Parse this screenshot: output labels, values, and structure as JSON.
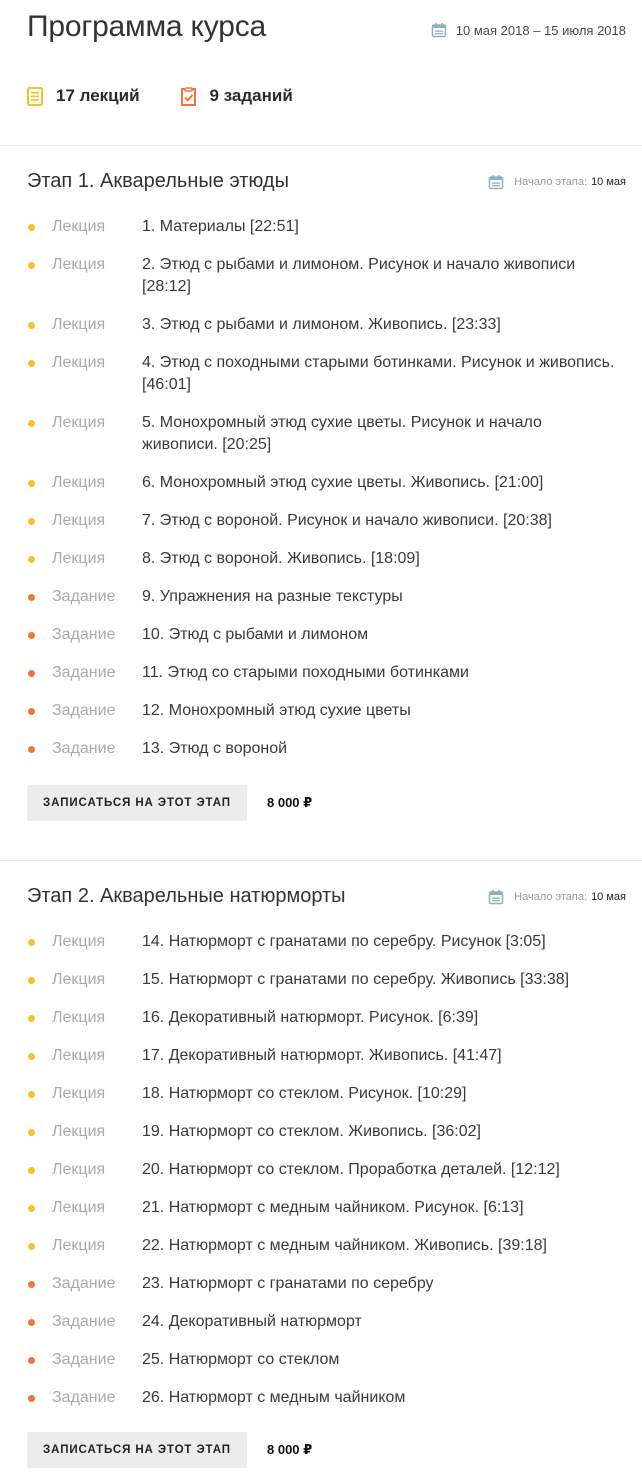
{
  "course": {
    "title": "Программа курса",
    "dates": "10 мая 2018 – 15 июля 2018",
    "lectures_count": "17 лекций",
    "tasks_count": "9 заданий"
  },
  "colors": {
    "lecture_dot": "#f6c12a",
    "task_dot": "#f0753a",
    "button_bg": "#ececec"
  },
  "stages": [
    {
      "title": "Этап 1. Акварельные этюды",
      "start_label": "Начало этапа:",
      "start_date": "10 мая",
      "button_label": "ЗАПИСАТЬСЯ НА ЭТОТ ЭТАП",
      "price": "8 000 ₽",
      "items": [
        {
          "kind": "Лекция",
          "type": "lecture",
          "title": "1. Материалы [22:51]"
        },
        {
          "kind": "Лекция",
          "type": "lecture",
          "title": "2. Этюд с рыбами и лимоном. Рисунок и начало живописи [28:12]"
        },
        {
          "kind": "Лекция",
          "type": "lecture",
          "title": "3. Этюд с рыбами и лимоном. Живопись. [23:33]"
        },
        {
          "kind": "Лекция",
          "type": "lecture",
          "title": "4. Этюд с походными старыми ботинками. Рисунок и живопись. [46:01]"
        },
        {
          "kind": "Лекция",
          "type": "lecture",
          "title": "5. Монохромный этюд сухие цветы. Рисунок и начало живописи. [20:25]"
        },
        {
          "kind": "Лекция",
          "type": "lecture",
          "title": "6. Монохромный этюд сухие цветы. Живопись. [21:00]"
        },
        {
          "kind": "Лекция",
          "type": "lecture",
          "title": "7. Этюд с вороной. Рисунок и начало живописи. [20:38]"
        },
        {
          "kind": "Лекция",
          "type": "lecture",
          "title": "8. Этюд с вороной. Живопись. [18:09]"
        },
        {
          "kind": "Задание",
          "type": "task",
          "title": "9. Упражнения на разные текстуры"
        },
        {
          "kind": "Задание",
          "type": "task",
          "title": "10. Этюд с рыбами и лимоном"
        },
        {
          "kind": "Задание",
          "type": "task",
          "title": "11. Этюд со старыми походными ботинками"
        },
        {
          "kind": "Задание",
          "type": "task",
          "title": "12. Монохромный этюд сухие цветы"
        },
        {
          "kind": "Задание",
          "type": "task",
          "title": "13. Этюд с вороной"
        }
      ]
    },
    {
      "title": "Этап 2. Акварельные натюрморты",
      "start_label": "Начало этапа:",
      "start_date": "10 мая",
      "button_label": "ЗАПИСАТЬСЯ НА ЭТОТ ЭТАП",
      "price": "8 000 ₽",
      "items": [
        {
          "kind": "Лекция",
          "type": "lecture",
          "title": "14. Натюрморт с гранатами по серебру. Рисунок [3:05]"
        },
        {
          "kind": "Лекция",
          "type": "lecture",
          "title": "15. Натюрморт с гранатами по серебру. Живопись [33:38]"
        },
        {
          "kind": "Лекция",
          "type": "lecture",
          "title": "16. Декоративный натюрморт. Рисунок. [6:39]"
        },
        {
          "kind": "Лекция",
          "type": "lecture",
          "title": "17. Декоративный натюрморт. Живопись. [41:47]"
        },
        {
          "kind": "Лекция",
          "type": "lecture",
          "title": "18. Натюрморт со стеклом. Рисунок. [10:29]"
        },
        {
          "kind": "Лекция",
          "type": "lecture",
          "title": "19. Натюрморт со стеклом. Живопись. [36:02]"
        },
        {
          "kind": "Лекция",
          "type": "lecture",
          "title": "20. Натюрморт со стеклом. Проработка деталей. [12:12]"
        },
        {
          "kind": "Лекция",
          "type": "lecture",
          "title": "21. Натюрморт с медным чайником. Рисунок. [6:13]"
        },
        {
          "kind": "Лекция",
          "type": "lecture",
          "title": "22. Натюрморт с медным чайником. Живопись. [39:18]"
        },
        {
          "kind": "Задание",
          "type": "task",
          "title": "23. Натюрморт с гранатами по серебру"
        },
        {
          "kind": "Задание",
          "type": "task",
          "title": "24. Декоративный натюрморт"
        },
        {
          "kind": "Задание",
          "type": "task",
          "title": "25. Натюрморт со стеклом"
        },
        {
          "kind": "Задание",
          "type": "task",
          "title": "26. Натюрморт с медным чайником"
        }
      ]
    }
  ]
}
